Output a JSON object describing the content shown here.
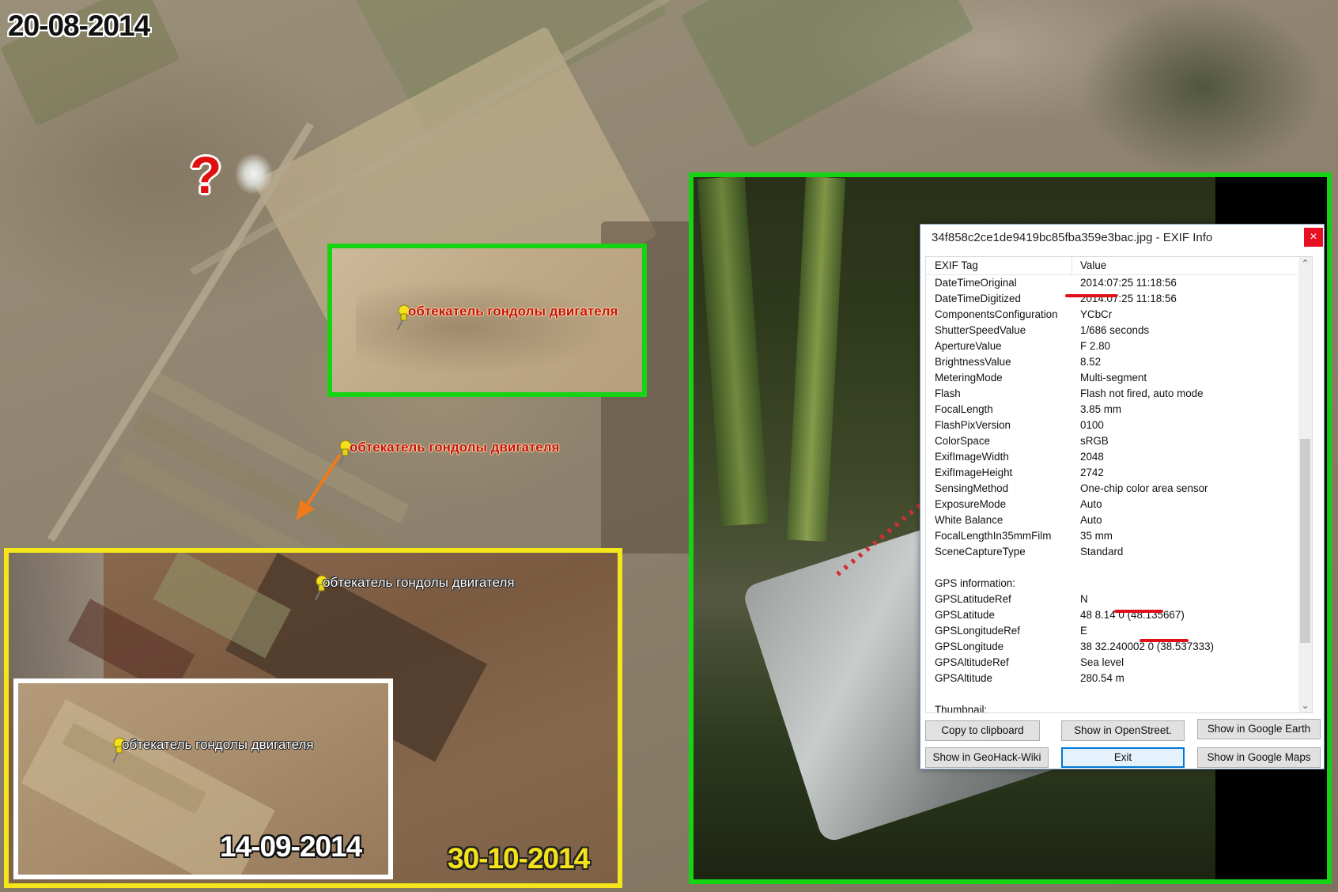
{
  "dates": {
    "main": "20-08-2014",
    "inset_white": "14-09-2014",
    "inset_yellow": "30-10-2014"
  },
  "question_mark": "?",
  "pin_label": "обтекатель гондолы двигателя",
  "exif_window": {
    "title": "34f858c2ce1de9419bc85fba359e3bac.jpg - EXIF Info",
    "close_label": "×",
    "header": {
      "tag": "EXIF Tag",
      "value": "Value"
    },
    "rows": [
      {
        "tag": "DateTimeOriginal",
        "value": "2014:07:25 11:18:56"
      },
      {
        "tag": "DateTimeDigitized",
        "value": "2014:07:25 11:18:56"
      },
      {
        "tag": "ComponentsConfiguration",
        "value": "YCbCr"
      },
      {
        "tag": "ShutterSpeedValue",
        "value": "1/686 seconds"
      },
      {
        "tag": "ApertureValue",
        "value": "F 2.80"
      },
      {
        "tag": "BrightnessValue",
        "value": "8.52"
      },
      {
        "tag": "MeteringMode",
        "value": "Multi-segment"
      },
      {
        "tag": "Flash",
        "value": "Flash not fired, auto mode"
      },
      {
        "tag": "FocalLength",
        "value": "3.85 mm"
      },
      {
        "tag": "FlashPixVersion",
        "value": "0100"
      },
      {
        "tag": "ColorSpace",
        "value": "sRGB"
      },
      {
        "tag": "ExifImageWidth",
        "value": "2048"
      },
      {
        "tag": "ExifImageHeight",
        "value": "2742"
      },
      {
        "tag": "SensingMethod",
        "value": "One-chip color area sensor"
      },
      {
        "tag": "ExposureMode",
        "value": "Auto"
      },
      {
        "tag": "White Balance",
        "value": "Auto"
      },
      {
        "tag": "FocalLengthIn35mmFilm",
        "value": "35 mm"
      },
      {
        "tag": "SceneCaptureType",
        "value": "Standard"
      },
      {
        "tag": "",
        "value": ""
      },
      {
        "tag": "GPS information:",
        "value": ""
      },
      {
        "tag": "GPSLatitudeRef",
        "value": "N"
      },
      {
        "tag": "GPSLatitude",
        "value": "48  8.14  0 (48.135667)"
      },
      {
        "tag": "GPSLongitudeRef",
        "value": "E"
      },
      {
        "tag": "GPSLongitude",
        "value": "38  32.240002  0 (38.537333)"
      },
      {
        "tag": "GPSAltitudeRef",
        "value": "Sea level"
      },
      {
        "tag": "GPSAltitude",
        "value": "280.54 m"
      },
      {
        "tag": "",
        "value": ""
      },
      {
        "tag": "Thumbnail:",
        "value": ""
      }
    ],
    "buttons": {
      "copy": "Copy to clipboard",
      "openstreet": "Show in OpenStreet.",
      "google_earth": "Show in Google Earth",
      "geohack": "Show in GeoHack-Wiki",
      "exit": "Exit",
      "google_maps": "Show in Google Maps"
    }
  },
  "colors": {
    "green_frame": "#14d414",
    "yellow_frame": "#f4e51c",
    "white_frame": "#ffffff",
    "annotation_red": "#e0101a",
    "arrow_orange": "#f07a1a"
  }
}
